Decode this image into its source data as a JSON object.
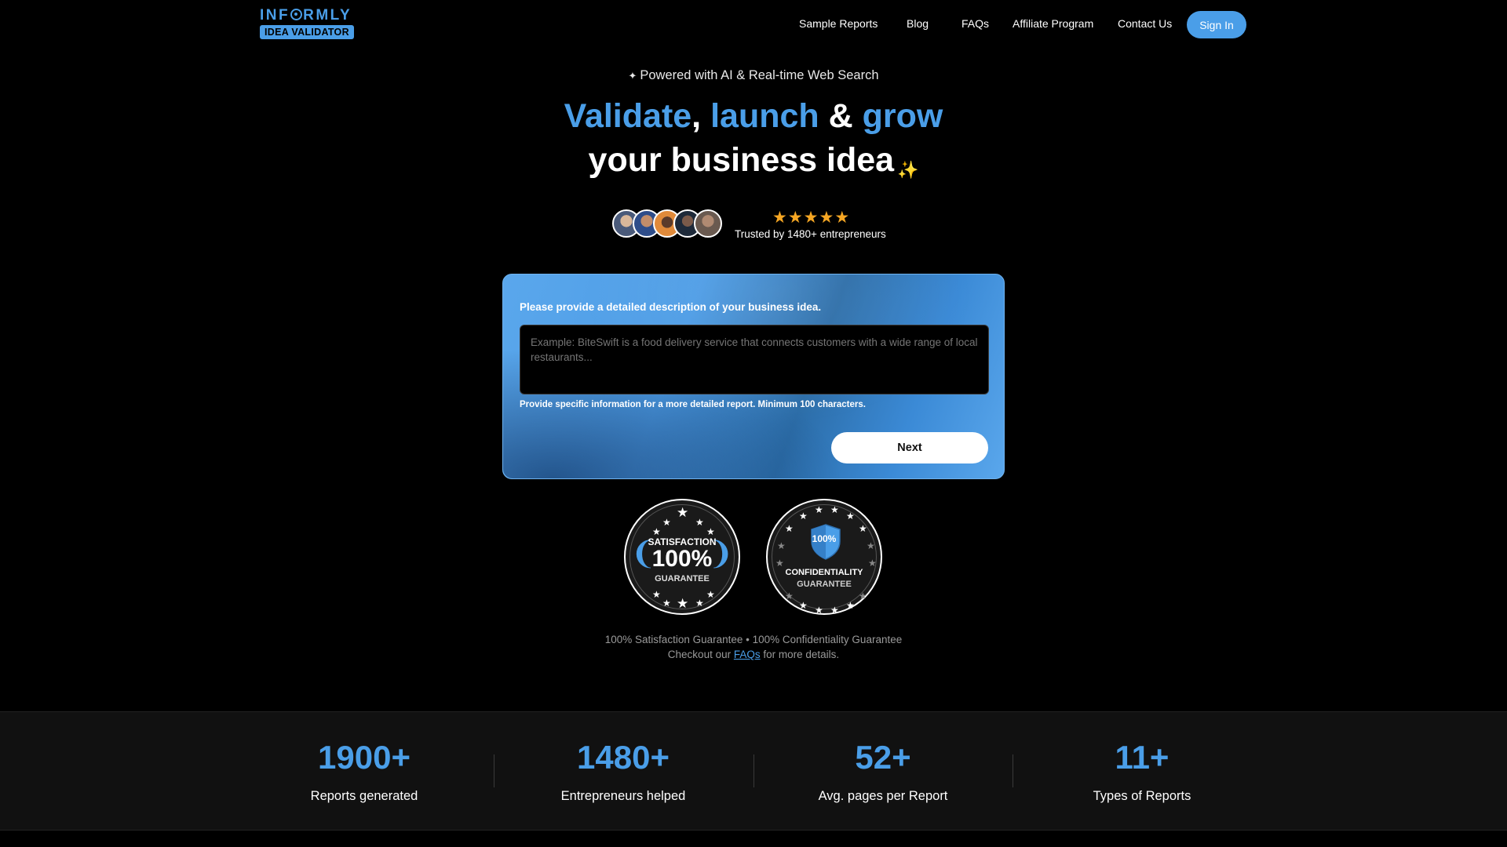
{
  "brand": {
    "logo_prefix": "INF",
    "logo_suffix": "RMLY",
    "logo_badge": "IDEA VALIDATOR",
    "accent": "#4a9ee8"
  },
  "nav": {
    "links": [
      "Sample Reports",
      "Blog",
      "FAQs",
      "Affiliate Program",
      "Contact Us"
    ],
    "signin": "Sign In"
  },
  "hero": {
    "powered": "Powered with AI & Real-time Web Search",
    "headline": {
      "word1": "Validate",
      "comma": ",",
      "word2": "launch",
      "amp": "&",
      "word3": "grow",
      "line2": "your business idea"
    },
    "rating_stars": 5,
    "trusted": "Trusted by 1480+ entrepreneurs"
  },
  "form": {
    "label": "Please provide a detailed description of your business idea.",
    "placeholder": "Example: BiteSwift is a food delivery service that connects customers with a wide range of local restaurants...",
    "hint": "Provide specific information for a more detailed report. Minimum 100 characters.",
    "next": "Next"
  },
  "badges": {
    "satisfaction": {
      "line1": "SATISFACTION",
      "line2": "100%",
      "line3": "GUARANTEE"
    },
    "confidentiality": {
      "shield": "100%",
      "line1": "CONFIDENTIALITY",
      "line2": "GUARANTEE"
    }
  },
  "guarantee": {
    "line1": "100% Satisfaction Guarantee • 100% Confidentiality Guarantee",
    "prefix": "Checkout our",
    "link": "FAQs",
    "suffix": "for more details."
  },
  "stats": [
    {
      "value": "1900+",
      "label": "Reports generated"
    },
    {
      "value": "1480+",
      "label": "Entrepreneurs helped"
    },
    {
      "value": "52+",
      "label": "Avg. pages per Report"
    },
    {
      "value": "11+",
      "label": "Types of Reports"
    }
  ]
}
